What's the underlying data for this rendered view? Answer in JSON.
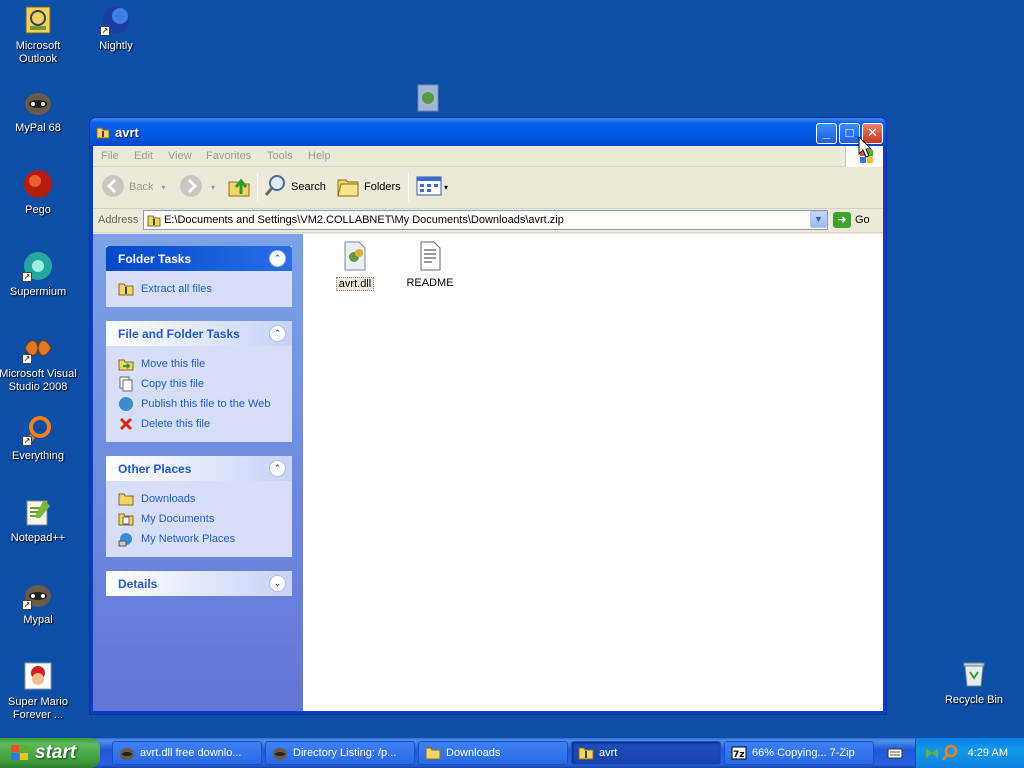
{
  "desktop": {
    "icons": [
      {
        "label": "Microsoft\nOutlook",
        "icon": "outlook-icon"
      },
      {
        "label": "Nightly",
        "icon": "nightly-icon"
      },
      {
        "label": "MyPal 68",
        "icon": "mypal-icon"
      },
      {
        "label": "Pego",
        "icon": "pego-icon"
      },
      {
        "label": "Supermium",
        "icon": "supermium-icon"
      },
      {
        "label": "Microsoft Visual Studio 2008",
        "icon": "visual-studio-icon"
      },
      {
        "label": "Everything",
        "icon": "everything-icon"
      },
      {
        "label": "Notepad++",
        "icon": "notepadpp-icon"
      },
      {
        "label": "Mypal",
        "icon": "mypal-icon"
      },
      {
        "label": "Super Mario Forever ...",
        "icon": "mario-icon"
      },
      {
        "label": "Recycle Bin",
        "icon": "recycle-bin-icon"
      }
    ]
  },
  "window": {
    "title": "avrt",
    "menu": [
      "File",
      "Edit",
      "View",
      "Favorites",
      "Tools",
      "Help"
    ],
    "toolbar": {
      "back_label": "Back",
      "search_label": "Search",
      "folders_label": "Folders"
    },
    "address": {
      "label": "Address",
      "value": "E:\\Documents and Settings\\VM2.COLLABNET\\My Documents\\Downloads\\avrt.zip",
      "go_label": "Go"
    },
    "taskpane": {
      "folder_tasks": {
        "title": "Folder Tasks",
        "items": [
          {
            "label": "Extract all files",
            "icon": "extract-icon"
          }
        ]
      },
      "file_folder_tasks": {
        "title": "File and Folder Tasks",
        "items": [
          {
            "label": "Move this file",
            "icon": "move-icon"
          },
          {
            "label": "Copy this file",
            "icon": "copy-icon"
          },
          {
            "label": "Publish this file to the Web",
            "icon": "publish-web-icon"
          },
          {
            "label": "Delete this file",
            "icon": "delete-icon"
          }
        ]
      },
      "other_places": {
        "title": "Other Places",
        "items": [
          {
            "label": "Downloads",
            "icon": "folder-icon"
          },
          {
            "label": "My Documents",
            "icon": "my-documents-icon"
          },
          {
            "label": "My Network Places",
            "icon": "network-places-icon"
          }
        ]
      },
      "details": {
        "title": "Details"
      }
    },
    "files": [
      {
        "name": "avrt.dll",
        "icon": "dll-file-icon",
        "selected": true
      },
      {
        "name": "README",
        "icon": "text-file-icon",
        "selected": false
      }
    ]
  },
  "taskbar": {
    "start_label": "start",
    "tasks": [
      {
        "label": "avrt.dll free downlo...",
        "icon": "browser-icon"
      },
      {
        "label": "Directory Listing: /p...",
        "icon": "browser-icon"
      },
      {
        "label": "Downloads",
        "icon": "folder-icon"
      },
      {
        "label": "avrt",
        "icon": "zip-folder-icon",
        "active": true
      },
      {
        "label": "66% Copying... 7-Zip",
        "icon": "7zip-icon"
      }
    ],
    "clock": "4:29 AM"
  },
  "colors": {
    "desktop_bg": "#0d4ea6",
    "title_blue": "#0058e6",
    "taskpane_blue": "#6375d6",
    "link_blue": "#215dc6",
    "start_green": "#3c9a3a"
  }
}
